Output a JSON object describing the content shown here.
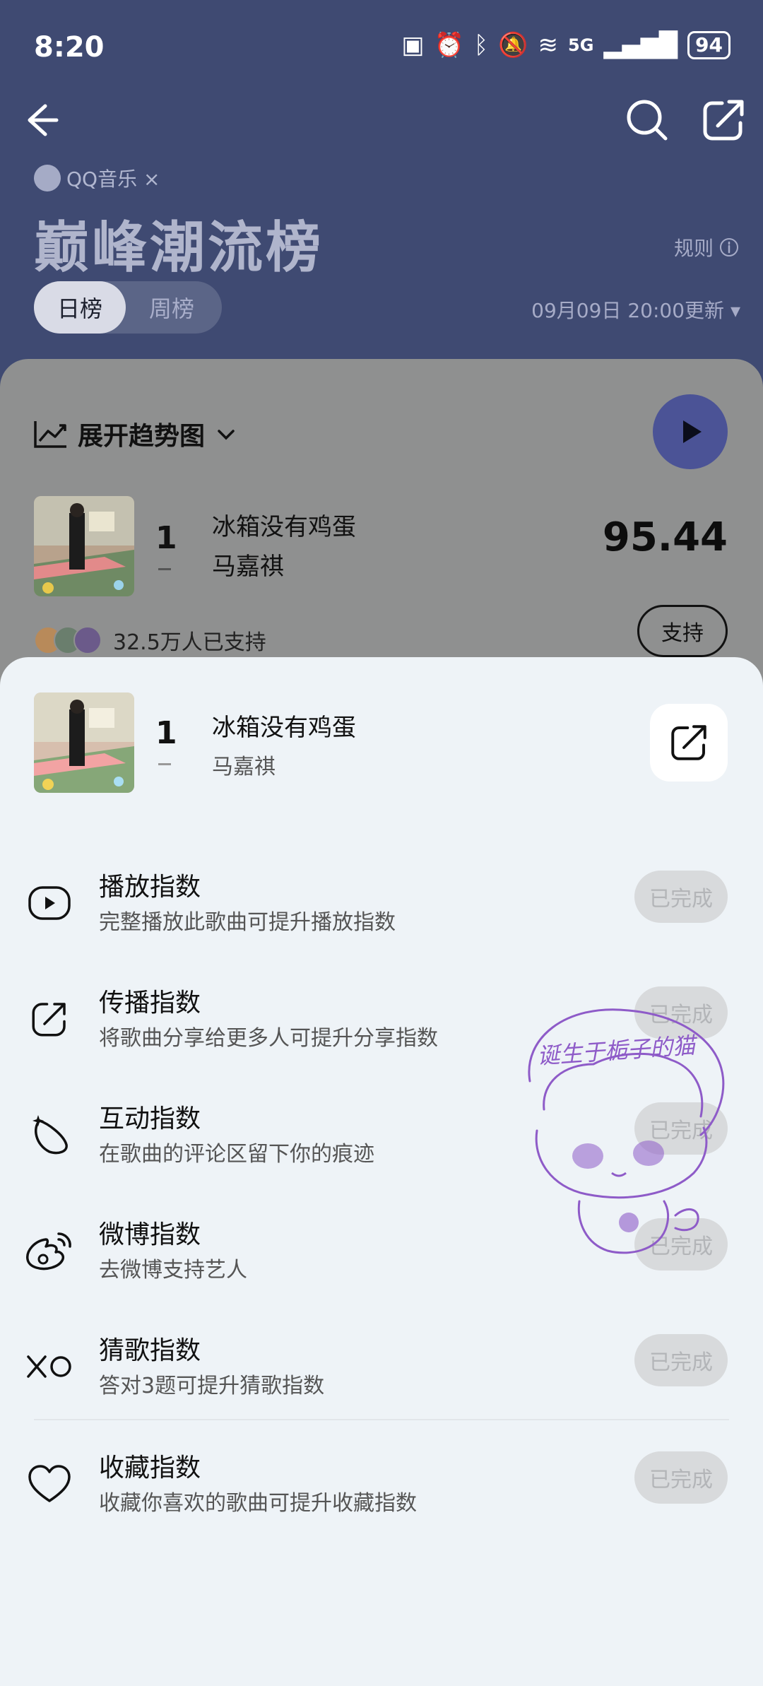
{
  "status": {
    "time": "8:20",
    "network": "5G",
    "battery": "94"
  },
  "header": {
    "brand": "QQ音乐 ×",
    "title": "巅峰潮流榜",
    "rules_label": "规则",
    "tabs": [
      {
        "label": "日榜",
        "active": true
      },
      {
        "label": "周榜",
        "active": false
      }
    ],
    "updated": "09月09日 20:00更新"
  },
  "chart_card": {
    "trend_label": "展开趋势图",
    "entry": {
      "rank": "1",
      "song": "冰箱没有鸡蛋",
      "artist": "马嘉祺",
      "score": "95.44"
    },
    "supporters": "32.5万人已支持",
    "support_button": "支持"
  },
  "sheet": {
    "entry": {
      "rank": "1",
      "song": "冰箱没有鸡蛋",
      "artist": "马嘉祺"
    },
    "tasks": [
      {
        "icon": "play-circle-icon",
        "name": "播放指数",
        "desc": "完整播放此歌曲可提升播放指数",
        "status": "已完成"
      },
      {
        "icon": "share-icon",
        "name": "传播指数",
        "desc": "将歌曲分享给更多人可提升分享指数",
        "status": "已完成"
      },
      {
        "icon": "sparkle-comment-icon",
        "name": "互动指数",
        "desc": "在歌曲的评论区留下你的痕迹",
        "status": "已完成"
      },
      {
        "icon": "weibo-icon",
        "name": "微博指数",
        "desc": "去微博支持艺人",
        "status": "已完成"
      },
      {
        "icon": "xo-icon",
        "name": "猜歌指数",
        "desc": "答对3题可提升猜歌指数",
        "status": "已完成"
      },
      {
        "icon": "heart-icon",
        "name": "收藏指数",
        "desc": "收藏你喜欢的歌曲可提升收藏指数",
        "status": "已完成"
      }
    ]
  },
  "sticker_text": "诞生于栀子的猫",
  "colors": {
    "header_bg": "#3f4a72",
    "play_button": "#4b5396",
    "sheet_bg": "#eef3f7",
    "sticker": "#8e5bc8"
  }
}
